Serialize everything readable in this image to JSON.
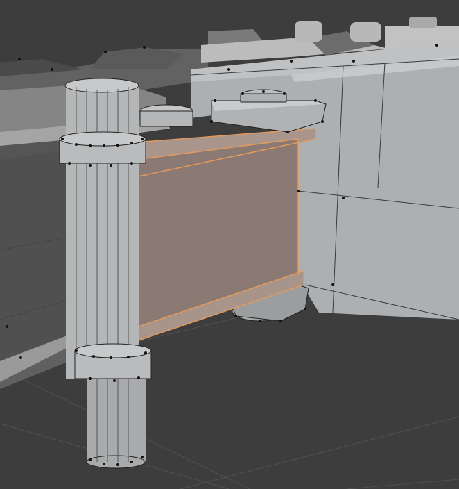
{
  "viewport": {
    "background": "#3d3d3d",
    "grid_color": "#505050",
    "edit_mode": "edge-select",
    "selection_color": "#e59a5c"
  },
  "objects": [
    {
      "name": "back-structure",
      "color": "#6f6f6f"
    },
    {
      "name": "left-rail-block",
      "color": "#505050"
    },
    {
      "name": "right-wall-block",
      "color": "#aeb1b3"
    },
    {
      "name": "pillar-cylinder",
      "color": "#b4b6b8"
    },
    {
      "name": "selected-panel",
      "color": "#8a7a73",
      "selected": true
    },
    {
      "name": "top-bracket",
      "color": "#b0b2b4"
    },
    {
      "name": "bottom-bracket",
      "color": "#a9abad"
    }
  ]
}
